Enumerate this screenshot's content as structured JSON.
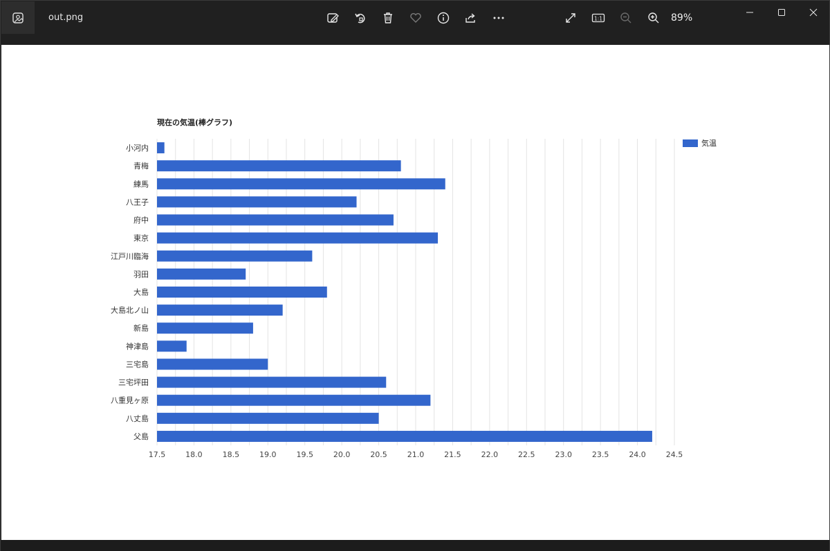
{
  "window": {
    "file_name": "out.png",
    "zoom": "89%",
    "ratio_label": "1:1"
  },
  "toolbar": {
    "icons": [
      "edit-image-icon",
      "rotate-icon",
      "delete-icon",
      "favorite-icon",
      "info-icon",
      "share-icon",
      "more-icon"
    ],
    "right_icons": [
      "fullscreen-icon",
      "actual-size-icon",
      "zoom-out-icon",
      "zoom-in-icon"
    ]
  },
  "colors": {
    "bar": "#3366cc",
    "grid": "#e3e3e3",
    "titlebar": "#202020"
  },
  "chart_data": {
    "type": "bar",
    "orientation": "horizontal",
    "title": "現在の気温(棒グラフ)",
    "legend": {
      "label": "気温",
      "position": "top-right"
    },
    "categories": [
      "小河内",
      "青梅",
      "練馬",
      "八王子",
      "府中",
      "東京",
      "江戸川臨海",
      "羽田",
      "大島",
      "大島北ノ山",
      "新島",
      "神津島",
      "三宅島",
      "三宅坪田",
      "八重見ヶ原",
      "八丈島",
      "父島"
    ],
    "series": [
      {
        "name": "気温",
        "values": [
          17.6,
          20.8,
          21.4,
          20.2,
          20.7,
          21.3,
          19.6,
          18.7,
          19.8,
          19.2,
          18.8,
          17.9,
          19.0,
          20.6,
          21.2,
          20.5,
          24.2
        ]
      }
    ],
    "xlim": [
      17.5,
      24.5
    ],
    "xticks": [
      "17.5",
      "18.0",
      "18.5",
      "19.0",
      "19.5",
      "20.0",
      "20.5",
      "21.0",
      "21.5",
      "22.0",
      "22.5",
      "23.0",
      "23.5",
      "24.0",
      "24.5"
    ],
    "grid": true
  }
}
